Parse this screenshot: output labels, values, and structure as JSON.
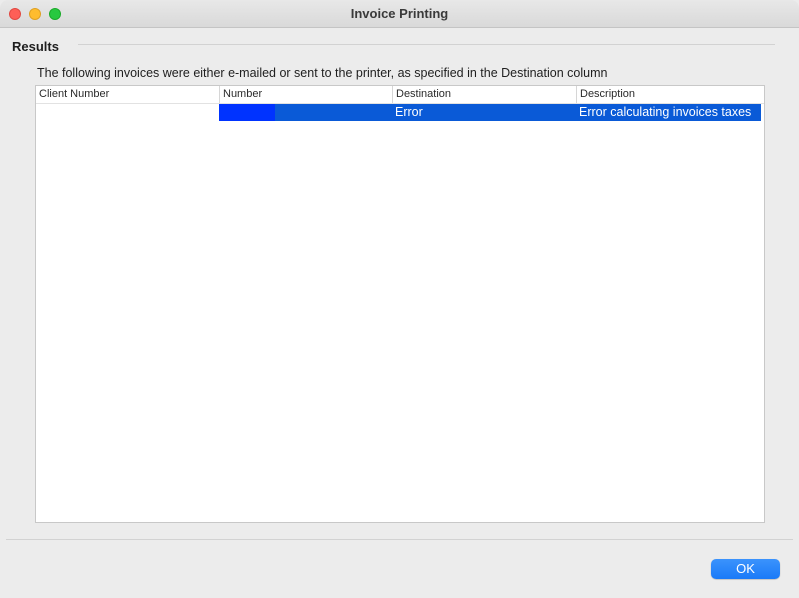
{
  "window": {
    "title": "Invoice Printing"
  },
  "results": {
    "section_title": "Results",
    "description": "The following invoices were either e-mailed or sent to the printer, as specified in the Destination column"
  },
  "table": {
    "columns": [
      "Client Number",
      "Number",
      "Destination",
      "Description"
    ],
    "rows": [
      {
        "client_number": "",
        "number": "",
        "destination": "Error",
        "description": "Error calculating invoices taxes",
        "selected": true
      }
    ]
  },
  "footer": {
    "ok_label": "OK"
  },
  "colors": {
    "selection": "#0a5ad7",
    "accent_button": "#1a7af8",
    "close": "#fe5f57",
    "minimize": "#febc2e",
    "zoom": "#28c840"
  }
}
